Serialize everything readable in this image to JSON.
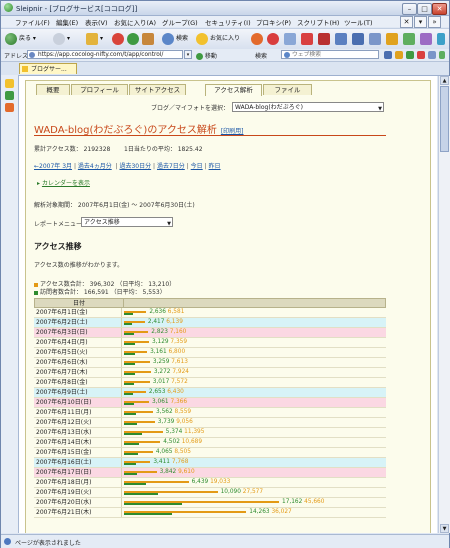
{
  "browser": {
    "title": "Sleipnir - [ブログサービス[ココログ]]",
    "menus": [
      "ファイル(F)",
      "編集(E)",
      "表示(V)",
      "お気に入り(A)",
      "グループ(G)",
      "セキュリティ(I)",
      "プロキシ(P)",
      "スクリプト(H)",
      "ツール(T)"
    ],
    "toolbar": {
      "back": "戻る",
      "search": "検索",
      "favorites": "お気に入り"
    },
    "address_label": "アドレス",
    "address": "https://app.cocolog-nifty.com/t/app/control/",
    "go_label": "移動",
    "search_label": "検索",
    "search_placeholder": "ウェブ検索",
    "tab_label": "ブログサー...",
    "status": "ページが表示されました"
  },
  "page": {
    "tabs": [
      "概要",
      "プロフィール",
      "サイトアクセス",
      "アクセス解析",
      "ファイル"
    ],
    "blog_select_label": "ブログ／マイフォトを選択：",
    "blog_select_value": "WADA-blog(わだぶろぐ)",
    "heading": "WADA-blog(わだぶろぐ)のアクセス解析",
    "print_label": "[印刷用]",
    "total_access": "累計アクセス数： 2192328",
    "daily_avg": "1日当たりの平均： 1825.42",
    "nav": [
      "←2007年 3月",
      "過去4ヵ月分",
      "過去30日分",
      "過去7日分",
      "今日",
      "昨日"
    ],
    "calendar_label": "カレンダーを表示",
    "period": "解析対象期間： 2007年6月1日(金) 〜 2007年6月30日(土)",
    "report_menu_label": "レポートメニュー：",
    "report_menu_value": "アクセス推移",
    "section_title": "アクセス推移",
    "section_desc": "アクセス数の推移がわかります。",
    "access_total": "アクセス数合計： 396,302 （日平均： 13,210）",
    "visitor_total": "訪問者数合計： 166,591 （日平均： 5,553）",
    "col_header": "日付",
    "colors": {
      "access": "#e39a15",
      "visitor": "#2e8b2e",
      "saturday": "#d7f3f7",
      "sunday": "#fbd8e3"
    }
  },
  "rows": [
    {
      "date": "2007年6月1日(金)",
      "visitors": 2636,
      "access": 6581,
      "day": "wk"
    },
    {
      "date": "2007年6月2日(土)",
      "visitors": 2417,
      "access": 6139,
      "day": "sat"
    },
    {
      "date": "2007年6月3日(日)",
      "visitors": 2823,
      "access": 7160,
      "day": "sun"
    },
    {
      "date": "2007年6月4日(月)",
      "visitors": 3129,
      "access": 7359,
      "day": "wk"
    },
    {
      "date": "2007年6月5日(火)",
      "visitors": 3161,
      "access": 6800,
      "day": "wk"
    },
    {
      "date": "2007年6月6日(水)",
      "visitors": 3259,
      "access": 7613,
      "day": "wk"
    },
    {
      "date": "2007年6月7日(木)",
      "visitors": 3272,
      "access": 7924,
      "day": "wk"
    },
    {
      "date": "2007年6月8日(金)",
      "visitors": 3017,
      "access": 7572,
      "day": "wk"
    },
    {
      "date": "2007年6月9日(土)",
      "visitors": 2653,
      "access": 6430,
      "day": "sat"
    },
    {
      "date": "2007年6月10日(日)",
      "visitors": 3061,
      "access": 7366,
      "day": "sun"
    },
    {
      "date": "2007年6月11日(月)",
      "visitors": 3562,
      "access": 8559,
      "day": "wk"
    },
    {
      "date": "2007年6月12日(火)",
      "visitors": 3739,
      "access": 9056,
      "day": "wk"
    },
    {
      "date": "2007年6月13日(水)",
      "visitors": 5374,
      "access": 11395,
      "day": "wk"
    },
    {
      "date": "2007年6月14日(木)",
      "visitors": 4502,
      "access": 10689,
      "day": "wk"
    },
    {
      "date": "2007年6月15日(金)",
      "visitors": 4065,
      "access": 8505,
      "day": "wk"
    },
    {
      "date": "2007年6月16日(土)",
      "visitors": 3411,
      "access": 7768,
      "day": "sat"
    },
    {
      "date": "2007年6月17日(日)",
      "visitors": 3842,
      "access": 9610,
      "day": "sun"
    },
    {
      "date": "2007年6月18日(月)",
      "visitors": 6439,
      "access": 19033,
      "day": "wk"
    },
    {
      "date": "2007年6月19日(火)",
      "visitors": 10090,
      "access": 27577,
      "day": "wk"
    },
    {
      "date": "2007年6月20日(水)",
      "visitors": 17162,
      "access": 45660,
      "day": "wk"
    },
    {
      "date": "2007年6月21日(木)",
      "visitors": 14263,
      "access": 36027,
      "day": "wk"
    }
  ],
  "chart_data": {
    "type": "bar",
    "categories": [
      "2007年6月1日(金)",
      "2007年6月2日(土)",
      "2007年6月3日(日)",
      "2007年6月4日(月)",
      "2007年6月5日(火)",
      "2007年6月6日(水)",
      "2007年6月7日(木)",
      "2007年6月8日(金)",
      "2007年6月9日(土)",
      "2007年6月10日(日)",
      "2007年6月11日(月)",
      "2007年6月12日(火)",
      "2007年6月13日(水)",
      "2007年6月14日(木)",
      "2007年6月15日(金)",
      "2007年6月16日(土)",
      "2007年6月17日(日)",
      "2007年6月18日(月)",
      "2007年6月19日(火)",
      "2007年6月20日(水)",
      "2007年6月21日(木)"
    ],
    "series": [
      {
        "name": "訪問者数",
        "values": [
          2636,
          2417,
          2823,
          3129,
          3161,
          3259,
          3272,
          3017,
          2653,
          3061,
          3562,
          3739,
          5374,
          4502,
          4065,
          3411,
          3842,
          6439,
          10090,
          17162,
          14263
        ]
      },
      {
        "name": "アクセス数",
        "values": [
          6581,
          6139,
          7160,
          7359,
          6800,
          7613,
          7924,
          7572,
          6430,
          7366,
          8559,
          9056,
          11395,
          10689,
          8505,
          7768,
          9610,
          19033,
          27577,
          45660,
          36027
        ]
      }
    ],
    "xlabel": "日付"
  }
}
